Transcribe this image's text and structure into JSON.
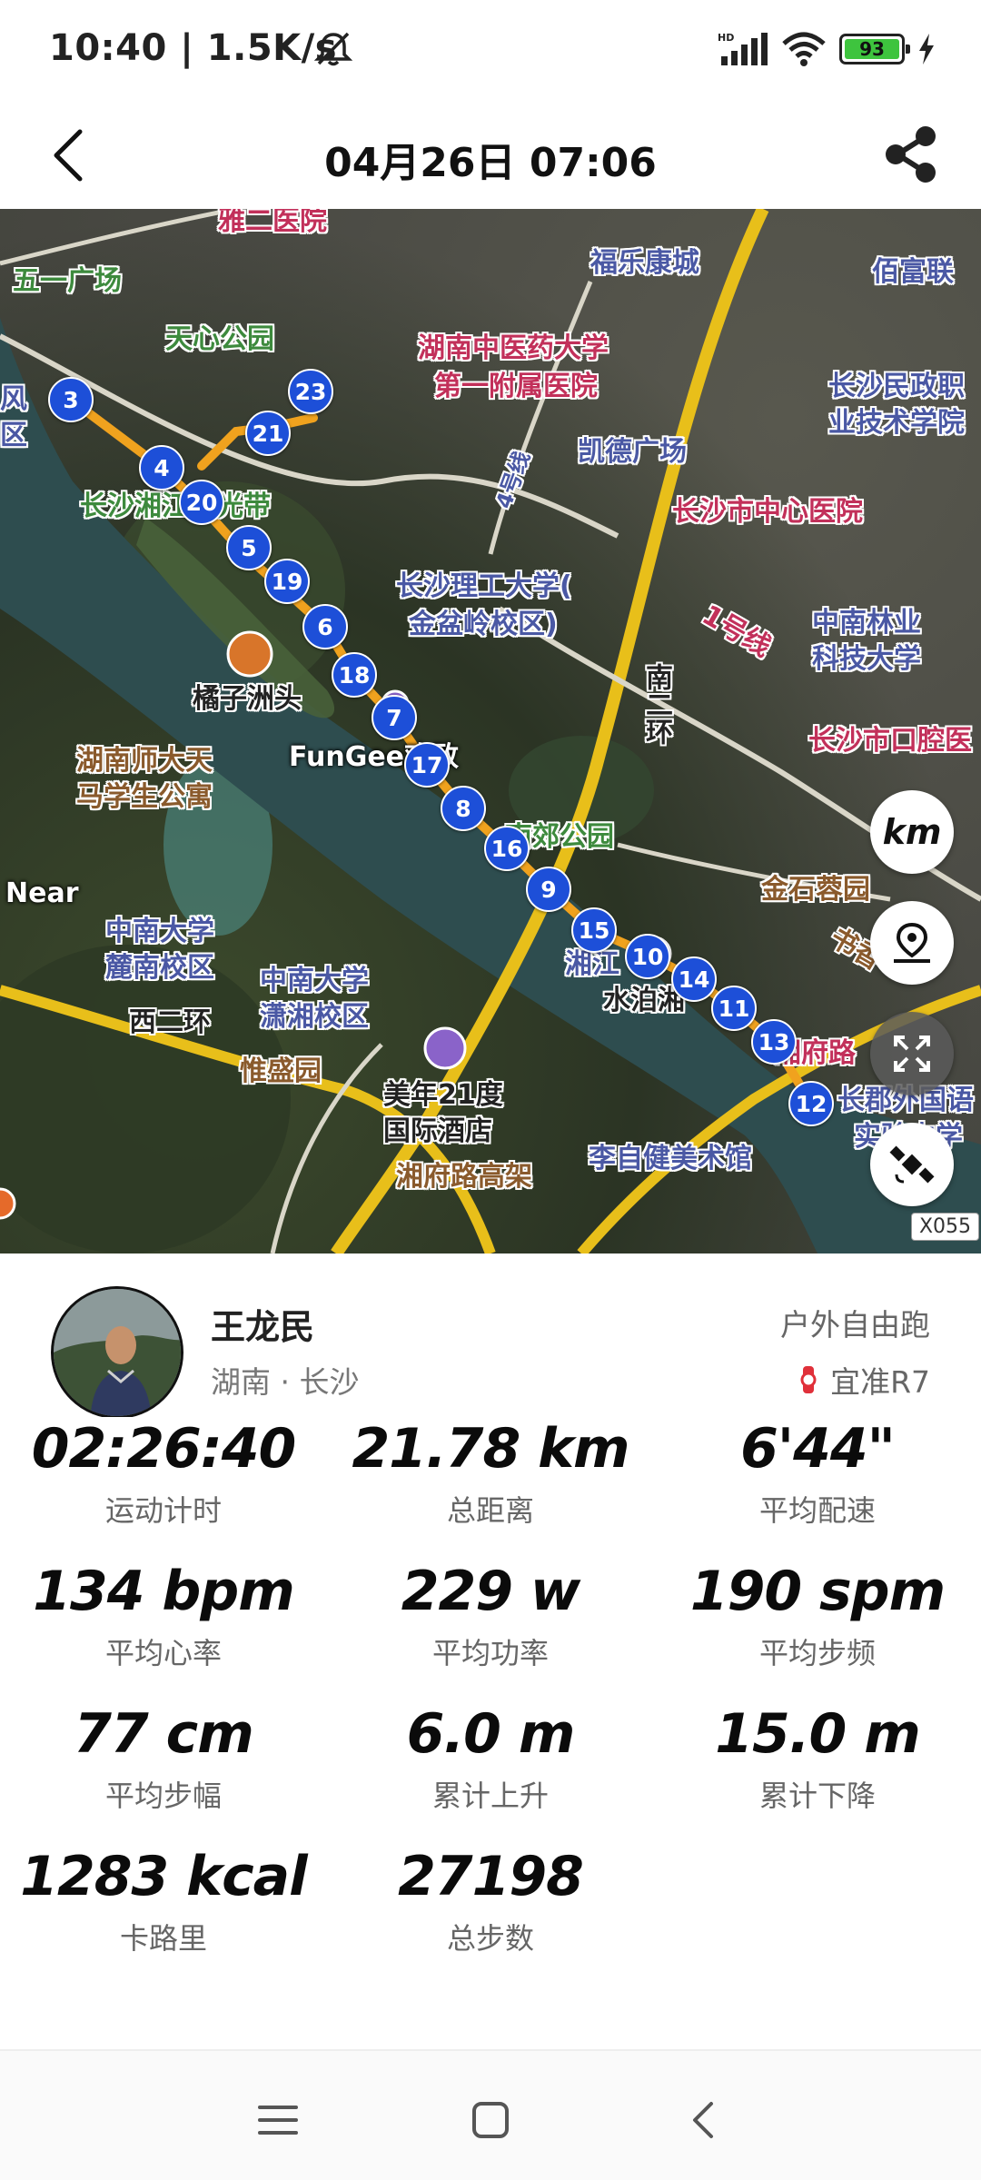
{
  "status_bar": {
    "time_speed": "10:40 | 1.5K/s",
    "battery_level": "93",
    "network_tag": "HD"
  },
  "header": {
    "title": "04月26日 07:06"
  },
  "map": {
    "labels": [
      {
        "text": "雅二医院",
        "color": "red"
      },
      {
        "text": "五一广场",
        "color": "green"
      },
      {
        "text": "天心公园",
        "color": "green"
      },
      {
        "text": "福乐康城",
        "color": "blue"
      },
      {
        "text": "佰富联",
        "color": "blue"
      },
      {
        "text": "湖南中医药大学",
        "color": "red"
      },
      {
        "text": "第一附属医院",
        "color": "red"
      },
      {
        "text": "长沙民政职",
        "color": "blue"
      },
      {
        "text": "业技术学院",
        "color": "blue"
      },
      {
        "text": "凯德广场",
        "color": "blue"
      },
      {
        "text": "长沙湘江风光带",
        "color": "green"
      },
      {
        "text": "长沙市中心医院",
        "color": "red"
      },
      {
        "text": "长沙理工大学(",
        "color": "blue"
      },
      {
        "text": "金盆岭校区)",
        "color": "blue"
      },
      {
        "text": "中南林业",
        "color": "blue"
      },
      {
        "text": "科技大学",
        "color": "blue"
      },
      {
        "text": "橘子洲头",
        "color": "dark"
      },
      {
        "text": "湖南师大天",
        "color": "brown"
      },
      {
        "text": "马学生公寓",
        "color": "brown"
      },
      {
        "text": "FunGee欢致",
        "color": "white"
      },
      {
        "text": "长沙市口腔医",
        "color": "red"
      },
      {
        "text": "南郊公园",
        "color": "green"
      },
      {
        "text": "金石蓉园",
        "color": "brown"
      },
      {
        "text": "Near",
        "color": "white"
      },
      {
        "text": "中南大学",
        "color": "blue"
      },
      {
        "text": "麓南校区",
        "color": "blue"
      },
      {
        "text": "中南大学",
        "color": "blue"
      },
      {
        "text": "潇湘校区",
        "color": "blue"
      },
      {
        "text": "湘江",
        "color": "blue"
      },
      {
        "text": "水泊湘",
        "color": "dark"
      },
      {
        "text": "湘府路",
        "color": "red"
      },
      {
        "text": "西二环",
        "color": "dark"
      },
      {
        "text": "惟盛园",
        "color": "brown"
      },
      {
        "text": "美年21度",
        "color": "dark"
      },
      {
        "text": "国际酒店",
        "color": "dark"
      },
      {
        "text": "湘府路高架",
        "color": "brown"
      },
      {
        "text": "李自健美术馆",
        "color": "blue"
      },
      {
        "text": "长郡外国语",
        "color": "blue"
      },
      {
        "text": "实验中学",
        "color": "blue"
      },
      {
        "text": "南二环",
        "color": "dark"
      },
      {
        "text": "1号线",
        "color": "red"
      },
      {
        "text": "4号线",
        "color": "blue"
      },
      {
        "text": "书香",
        "color": "brown"
      },
      {
        "text": "风",
        "color": "blue"
      },
      {
        "text": "区",
        "color": "blue"
      }
    ],
    "km_markers": [
      "3",
      "4",
      "20",
      "21",
      "23",
      "5",
      "19",
      "6",
      "18",
      "7",
      "17",
      "8",
      "16",
      "9",
      "15",
      "10",
      "14",
      "11",
      "13",
      "12"
    ],
    "unit_toggle": "km",
    "road_tag": "X055"
  },
  "profile": {
    "name": "王龙民",
    "location": "湖南 · 长沙",
    "activity_type": "户外自由跑",
    "device": "宜准R7"
  },
  "stats": [
    {
      "value": "02:26:40",
      "label": "运动计时"
    },
    {
      "value": "21.78 km",
      "label": "总距离"
    },
    {
      "value": "6'44\"",
      "label": "平均配速"
    },
    {
      "value": "134 bpm",
      "label": "平均心率"
    },
    {
      "value": "229 w",
      "label": "平均功率"
    },
    {
      "value": "190 spm",
      "label": "平均步频"
    },
    {
      "value": "77 cm",
      "label": "平均步幅"
    },
    {
      "value": "6.0 m",
      "label": "累计上升"
    },
    {
      "value": "15.0 m",
      "label": "累计下降"
    },
    {
      "value": "1283 kcal",
      "label": "卡路里"
    },
    {
      "value": "27198",
      "label": "总步数"
    }
  ],
  "colors": {
    "route": "#f0a21e",
    "marker": "#1d4fd8",
    "river": "#2e4d4f",
    "road": "#f0c400"
  }
}
